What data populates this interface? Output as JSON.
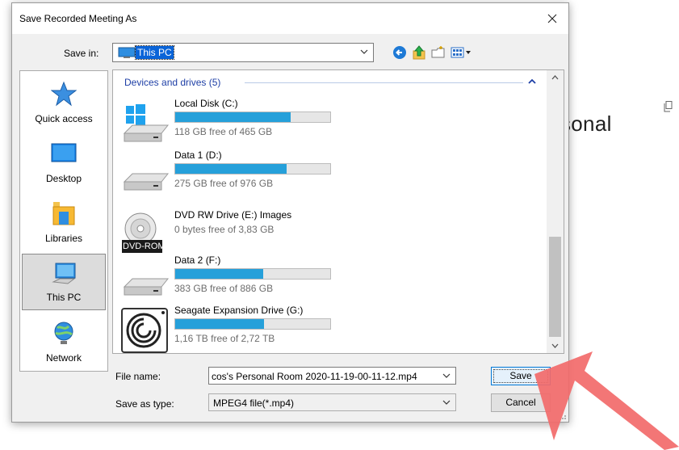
{
  "background": {
    "partial_text": "sonal",
    "copy_icon": "copy-icon"
  },
  "dialog": {
    "title": "Save Recorded Meeting As",
    "close_icon": "close-icon",
    "save_in": {
      "label": "Save in:",
      "value": "This PC",
      "icon": "this-pc-icon"
    },
    "toolbar": {
      "back_icon": "back-arrow-icon",
      "up_icon": "up-folder-icon",
      "new_folder_icon": "new-folder-icon",
      "view_menu_icon": "view-menu-icon"
    },
    "places": [
      {
        "label": "Quick access",
        "icon": "star-icon",
        "selected": false
      },
      {
        "label": "Desktop",
        "icon": "desktop-icon",
        "selected": false
      },
      {
        "label": "Libraries",
        "icon": "libraries-icon",
        "selected": false
      },
      {
        "label": "This PC",
        "icon": "computer-icon",
        "selected": true
      },
      {
        "label": "Network",
        "icon": "network-icon",
        "selected": false
      }
    ],
    "group": {
      "header": "Devices and drives (5)"
    },
    "drives": [
      {
        "name": "Local Disk (C:)",
        "free": "118 GB free of 465 GB",
        "used_fraction": 0.746,
        "icon": "windows-drive-icon"
      },
      {
        "name": "Data 1 (D:)",
        "free": "275 GB free of 976 GB",
        "used_fraction": 0.718,
        "icon": "hard-drive-icon"
      },
      {
        "name": "DVD RW Drive (E:) Images",
        "free": "0 bytes free of 3,83 GB",
        "used_fraction": null,
        "icon": "dvd-drive-icon",
        "badge": "DVD-ROM"
      },
      {
        "name": "Data 2 (F:)",
        "free": "383 GB free of 886 GB",
        "used_fraction": 0.568,
        "icon": "hard-drive-icon"
      },
      {
        "name": "Seagate Expansion Drive (G:)",
        "free": "1,16 TB free of 2,72 TB",
        "used_fraction": 0.574,
        "icon": "seagate-drive-icon"
      }
    ],
    "file_name": {
      "label": "File name:",
      "value": "cos's Personal Room 2020-11-19-00-11-12.mp4"
    },
    "save_as_type": {
      "label": "Save as type:",
      "value": "MPEG4 file(*.mp4)"
    },
    "buttons": {
      "save": "Save",
      "cancel": "Cancel"
    }
  },
  "colors": {
    "selection_blue": "#0a64d8",
    "drive_bar": "#26a0da",
    "group_header": "#1e3fa6",
    "annotation_arrow": "#f26a6a"
  }
}
